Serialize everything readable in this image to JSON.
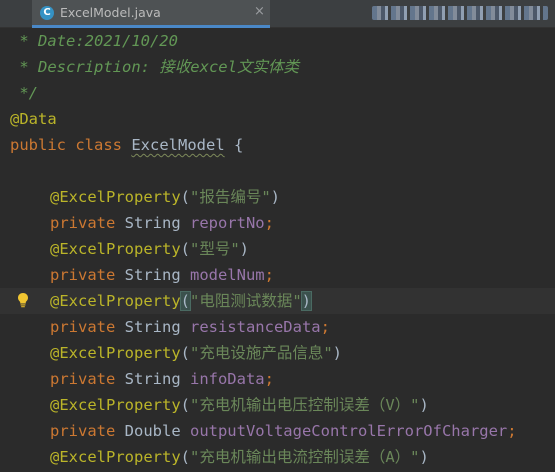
{
  "tab": {
    "icon_letter": "C",
    "title": "ExcelModel.java",
    "close_glyph": "×"
  },
  "code": {
    "l1_comment": " * Date:2021/10/20",
    "l2_comment": " * Description: 接收excel文实体类",
    "l3_comment": " */",
    "l4_annotation": "@Data",
    "l5_kw": "public class ",
    "l5_class": "ExcelModel",
    "l5_brace": " {",
    "annotation_name": "@ExcelProperty",
    "private_kw": "private ",
    "type_string": "String ",
    "type_double": "Double ",
    "semicolon": ";",
    "open_paren": "(",
    "close_paren": ")",
    "s1": "\"报告编号\"",
    "f1": "reportNo",
    "s2": "\"型号\"",
    "f2": "modelNum",
    "s3": "\"电阻测试数据\"",
    "f3": "resistanceData",
    "s4": "\"充电设施产品信息\"",
    "f4": "infoData",
    "s5": "\"充电机输出电压控制误差（V）\"",
    "f5": "outputVoltageControlErrorOfCharger",
    "s6": "\"充电机输出电流控制误差（A）\""
  }
}
